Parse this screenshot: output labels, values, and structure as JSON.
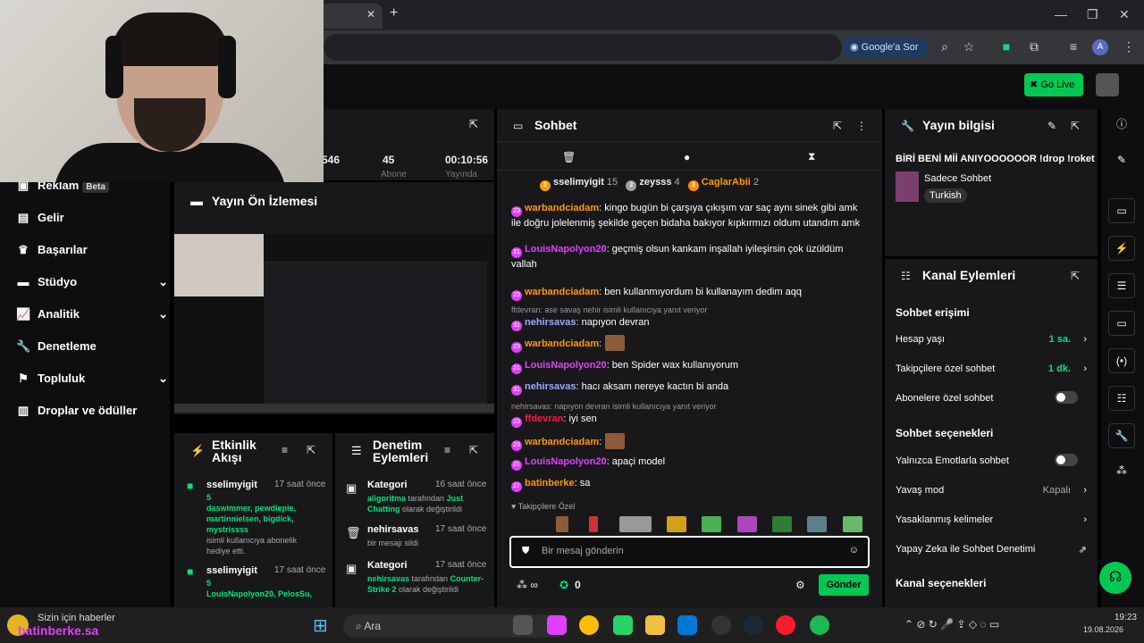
{
  "browser": {
    "tab_title_fragment": "d",
    "google_btn": "Google'a Sor",
    "profile_initial": "A"
  },
  "app": {
    "go_live": "Go Live"
  },
  "nav": {
    "items": [
      {
        "label": "Reklam",
        "badge": "Beta"
      },
      {
        "label": "Gelir"
      },
      {
        "label": "Başarılar"
      },
      {
        "label": "Stüdyo"
      },
      {
        "label": "Analitik"
      },
      {
        "label": "Denetleme"
      },
      {
        "label": "Topluluk"
      },
      {
        "label": "Droplar ve ödüller"
      }
    ]
  },
  "stats": {
    "viewers": "546",
    "followers": "45",
    "followers_label": "Abone",
    "uptime": "00:10:56",
    "uptime_label": "Yayında"
  },
  "preview": {
    "title": "Yayın Ön İzlemesi"
  },
  "activity": {
    "title_line1": "Etkinlik",
    "title_line2": "Akışı",
    "items": [
      {
        "user": "sselimyigit",
        "time": "17 saat önce",
        "count": "5",
        "names": "daswimmer, pewdiepie, martinnielsen, bigdick, mystrissss",
        "text": "isimli kullanıcıya abonelik hediye etti."
      },
      {
        "user": "sselimyigit",
        "time": "17 saat önce",
        "count": "5",
        "names": "LouisNapolyon20, PelosSu,",
        "text": ""
      }
    ]
  },
  "mod": {
    "title_line1": "Denetim",
    "title_line2": "Eylemleri",
    "items": [
      {
        "title": "Kategori",
        "time": "16 saat önce",
        "actor": "aligoritma",
        "mid": " tarafından ",
        "target": "Just Chatting",
        "end": " olarak değiştirildi"
      },
      {
        "title": "nehirsavas",
        "time": "17 saat önce",
        "actor": "",
        "mid": "bir mesajı sildi",
        "target": "",
        "end": ""
      },
      {
        "title": "Kategori",
        "time": "17 saat önce",
        "actor": "nehirsavas",
        "mid": " tarafından ",
        "target": "Counter-Strike 2",
        "end": " olarak değiştirildi"
      }
    ]
  },
  "chat": {
    "title": "Sohbet",
    "top": [
      {
        "name": "sselimyigit",
        "count": "15",
        "rank": "1"
      },
      {
        "name": "zeysss",
        "count": "4",
        "rank": "2"
      },
      {
        "name": "CaglarAbii",
        "count": "2",
        "rank": "3"
      }
    ],
    "messages": [
      {
        "badge": "23",
        "user": "warbandciadam",
        "color": "#ff9800",
        "text": ": kingo bugün bi çarşıya çıkışım var saç aynı sinek gibi amk ile doğru jolelenmiş şekilde geçen bidaha bakıyor kıpkırmızı oldum utandım amk",
        "reply": ""
      },
      {
        "badge": "21",
        "user": "LouisNapolyon20",
        "color": "#e040fb",
        "text": ": geçmiş olsun kankam inşallah iyileşirsin çok üzüldüm vallah",
        "reply": ""
      },
      {
        "badge": "23",
        "user": "warbandciadam",
        "color": "#ff9800",
        "text": ": ben kullanmıyordum bi kullanayım dedim aqq",
        "reply": ""
      },
      {
        "badge": "31",
        "user": "nehirsavas",
        "color": "#9fa8ff",
        "text": ": napıyon devran",
        "reply": "ffdevran: ase savaş nehir isimli kullanıcıya yanıt veriyor"
      },
      {
        "badge": "23",
        "user": "warbandciadam",
        "color": "#ff9800",
        "text": ":",
        "reply": "",
        "emote": true
      },
      {
        "badge": "21",
        "user": "LouisNapolyon20",
        "color": "#e040fb",
        "text": ": ben Spider wax kullanıyorum",
        "reply": ""
      },
      {
        "badge": "31",
        "user": "nehirsavas",
        "color": "#9fa8ff",
        "text": ": hacı aksam nereye kactın bi anda",
        "reply": ""
      },
      {
        "badge": "23",
        "user": "ffdevran",
        "color": "#ff1744",
        "text": ": iyi sen",
        "reply": "nehirsavas: napıyon devran isimli kullanıcıya yanıt veriyor"
      },
      {
        "badge": "23",
        "user": "warbandciadam",
        "color": "#ff9800",
        "text": ":",
        "reply": "",
        "emote": true
      },
      {
        "badge": "21",
        "user": "LouisNapolyon20",
        "color": "#e040fb",
        "text": ": apaçi model",
        "reply": ""
      },
      {
        "badge": "27",
        "user": "batinberke",
        "color": "#ff9800",
        "text": ": sa",
        "reply": ""
      }
    ],
    "followers_only": "Takipçilere Özel",
    "placeholder": "Bir mesaj gönderin",
    "points": "0",
    "send": "Gönder"
  },
  "info": {
    "title": "Yayın bilgisi",
    "stream_title": "BİRİ BENİ Mİİ ANIYOOOOOOR !drop !roket",
    "category": "Sadece Sohbet",
    "language": "Turkish"
  },
  "kanal": {
    "title": "Kanal Eylemleri",
    "sec1": "Sohbet erişimi",
    "rows1": [
      {
        "label": "Hesap yaşı",
        "value": "1 sa."
      },
      {
        "label": "Takipçilere özel sohbet",
        "value": "1 dk."
      },
      {
        "label": "Abonelere özel sohbet",
        "value": ""
      }
    ],
    "sec2": "Sohbet seçenekleri",
    "rows2": [
      {
        "label": "Yalnızca Emotlarla sohbet",
        "value": ""
      },
      {
        "label": "Yavaş mod",
        "value": "Kapalı"
      },
      {
        "label": "Yasaklanmış kelimeler",
        "value": ""
      },
      {
        "label": "Yapay Zeka ile Sohbet Denetimi",
        "value": ""
      }
    ],
    "sec3": "Kanal seçenekleri"
  },
  "taskbar": {
    "news": "Sizin için haberler",
    "overlay": "batinberke.sa",
    "search": "Ara",
    "time": "19:23",
    "date": "19.08.2026"
  },
  "colors": {
    "accent": "#00c853",
    "panel": "#18181b",
    "bg": "#0e0e10"
  }
}
